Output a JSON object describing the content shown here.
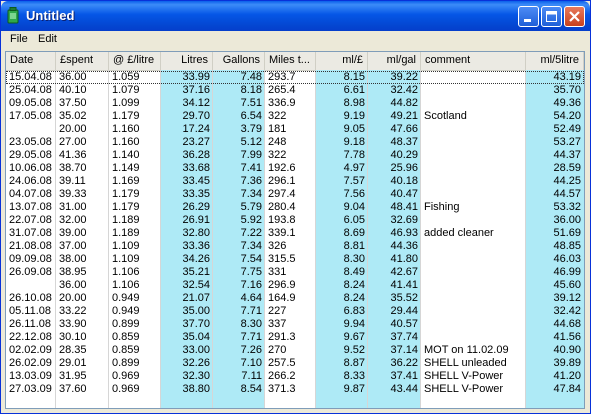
{
  "window": {
    "title": "Untitled",
    "accent": "#0A5FEA",
    "highlight_column_color": "#AEEAF6"
  },
  "menu": {
    "file": "File",
    "edit": "Edit"
  },
  "columns": [
    "Date",
    "£spent",
    "@ £/litre",
    "Litres",
    "Gallons",
    "Miles t...",
    "ml/£",
    "ml/gal",
    "comment",
    "ml/5litre"
  ],
  "rows": [
    [
      "15.04.08",
      "36.00",
      "1.059",
      "33.99",
      "7.48",
      "293.7",
      "8.15",
      "39.22",
      "",
      "43.19"
    ],
    [
      "25.04.08",
      "40.10",
      "1.079",
      "37.16",
      "8.18",
      "265.4",
      "6.61",
      "32.42",
      "",
      "35.70"
    ],
    [
      "09.05.08",
      "37.50",
      "1.099",
      "34.12",
      "7.51",
      "336.9",
      "8.98",
      "44.82",
      "",
      "49.36"
    ],
    [
      "17.05.08",
      "35.02",
      "1.179",
      "29.70",
      "6.54",
      "322",
      "9.19",
      "49.21",
      "Scotland",
      "54.20"
    ],
    [
      "",
      "20.00",
      "1.160",
      "17.24",
      "3.79",
      "181",
      "9.05",
      "47.66",
      "",
      "52.49"
    ],
    [
      "23.05.08",
      "27.00",
      "1.160",
      "23.27",
      "5.12",
      "248",
      "9.18",
      "48.37",
      "",
      "53.27"
    ],
    [
      "29.05.08",
      "41.36",
      "1.140",
      "36.28",
      "7.99",
      "322",
      "7.78",
      "40.29",
      "",
      "44.37"
    ],
    [
      "10.06.08",
      "38.70",
      "1.149",
      "33.68",
      "7.41",
      "192.6",
      "4.97",
      "25.96",
      "",
      "28.59"
    ],
    [
      "24.06.08",
      "39.11",
      "1.169",
      "33.45",
      "7.36",
      "296.1",
      "7.57",
      "40.18",
      "",
      "44.25"
    ],
    [
      "04.07.08",
      "39.33",
      "1.179",
      "33.35",
      "7.34",
      "297.4",
      "7.56",
      "40.47",
      "",
      "44.57"
    ],
    [
      "13.07.08",
      "31.00",
      "1.179",
      "26.29",
      "5.79",
      "280.4",
      "9.04",
      "48.41",
      "Fishing",
      "53.32"
    ],
    [
      "22.07.08",
      "32.00",
      "1.189",
      "26.91",
      "5.92",
      "193.8",
      "6.05",
      "32.69",
      "",
      "36.00"
    ],
    [
      "31.07.08",
      "39.00",
      "1.189",
      "32.80",
      "7.22",
      "339.1",
      "8.69",
      "46.93",
      "added cleaner",
      "51.69"
    ],
    [
      "21.08.08",
      "37.00",
      "1.109",
      "33.36",
      "7.34",
      "326",
      "8.81",
      "44.36",
      "",
      "48.85"
    ],
    [
      "09.09.08",
      "38.00",
      "1.109",
      "34.26",
      "7.54",
      "315.5",
      "8.30",
      "41.80",
      "",
      "46.03"
    ],
    [
      "26.09.08",
      "38.95",
      "1.106",
      "35.21",
      "7.75",
      "331",
      "8.49",
      "42.67",
      "",
      "46.99"
    ],
    [
      "",
      "36.00",
      "1.106",
      "32.54",
      "7.16",
      "296.9",
      "8.24",
      "41.41",
      "",
      "45.60"
    ],
    [
      "26.10.08",
      "20.00",
      "0.949",
      "21.07",
      "4.64",
      "164.9",
      "8.24",
      "35.52",
      "",
      "39.12"
    ],
    [
      "05.11.08",
      "33.22",
      "0.949",
      "35.00",
      "7.71",
      "227",
      "6.83",
      "29.44",
      "",
      "32.42"
    ],
    [
      "26.11.08",
      "33.90",
      "0.899",
      "37.70",
      "8.30",
      "337",
      "9.94",
      "40.57",
      "",
      "44.68"
    ],
    [
      "22.12.08",
      "30.10",
      "0.859",
      "35.04",
      "7.71",
      "291.3",
      "9.67",
      "37.74",
      "",
      "41.56"
    ],
    [
      "02.02.09",
      "28.35",
      "0.859",
      "33.00",
      "7.26",
      "270",
      "9.52",
      "37.14",
      "MOT on 11.02.09",
      "40.90"
    ],
    [
      "26.02.09",
      "29.01",
      "0.899",
      "32.26",
      "7.10",
      "257.5",
      "8.87",
      "36.22",
      "SHELL unleaded",
      "39.89"
    ],
    [
      "13.03.09",
      "31.95",
      "0.969",
      "32.30",
      "7.11",
      "266.2",
      "8.33",
      "37.41",
      "SHELL V-Power",
      "41.20"
    ],
    [
      "27.03.09",
      "37.60",
      "0.969",
      "38.80",
      "8.54",
      "371.3",
      "9.87",
      "43.44",
      "SHELL V-Power",
      "47.84"
    ]
  ]
}
